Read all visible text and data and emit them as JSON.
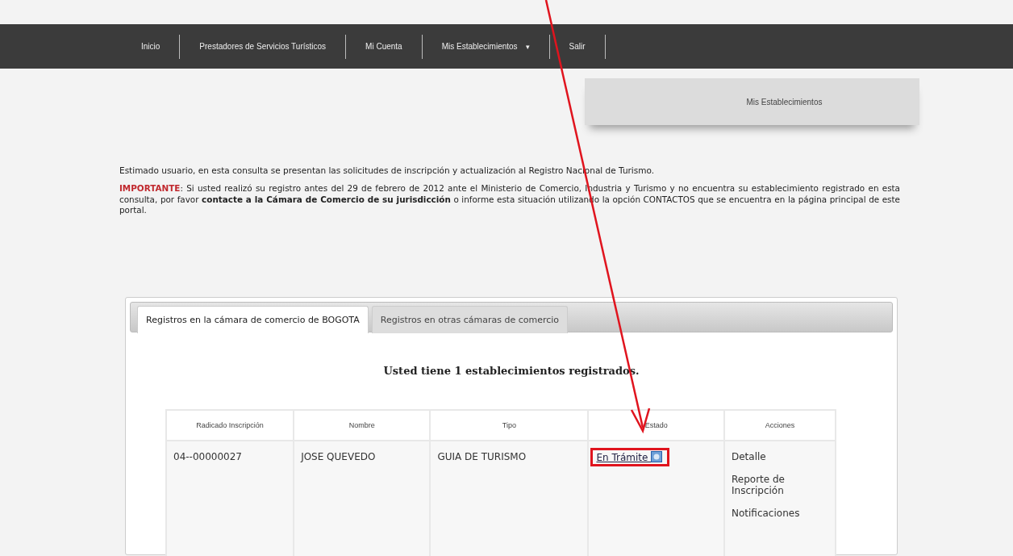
{
  "nav": [
    {
      "label": "Inicio",
      "dropdown": false
    },
    {
      "label": "Prestadores de Servicios Turísticos",
      "dropdown": false
    },
    {
      "label": "Mi Cuenta",
      "dropdown": false
    },
    {
      "label": "Mis Establecimientos",
      "dropdown": true
    },
    {
      "label": "Salir",
      "dropdown": false
    }
  ],
  "nav_dropdown_mark": "▾",
  "section_title": "Mis Establecimientos",
  "intro": "Estimado usuario, en esta consulta se presentan las solicitudes de inscripción y actualización al Registro Nacional de Turismo.",
  "important_label": "IMPORTANTE",
  "important_text": ": Si usted realizó su registro antes del 29 de febrero de 2012 ante el Ministerio de Comercio, Industria y Turismo y no encuentra su establecimiento registrado en esta consulta, por favor **contacte a la Cámara de Comercio de su jurisdicción** o informe esta situación utilizando la opción CONTACTOS que se encuentra en la página principal de este portal.",
  "tabs": [
    {
      "label": "Registros en la cámara de comercio de BOGOTA",
      "selected": true
    },
    {
      "label": "Registros en otras cámaras de comercio",
      "selected": false
    }
  ],
  "count_heading": "Usted tiene 1 establecimientos registrados.",
  "table": {
    "columns": [
      "Radicado Inscripción",
      "Nombre",
      "Tipo",
      "Estado",
      "Acciones"
    ],
    "rows": [
      {
        "radicado": "04--00000027",
        "nombre": "JOSE QUEVEDO",
        "tipo": "GUIA DE TURISMO",
        "estado": "En Trámite",
        "highlighted": true,
        "actions": [
          "Detalle",
          "Reporte de Inscripción",
          "Notificaciones"
        ]
      }
    ]
  }
}
